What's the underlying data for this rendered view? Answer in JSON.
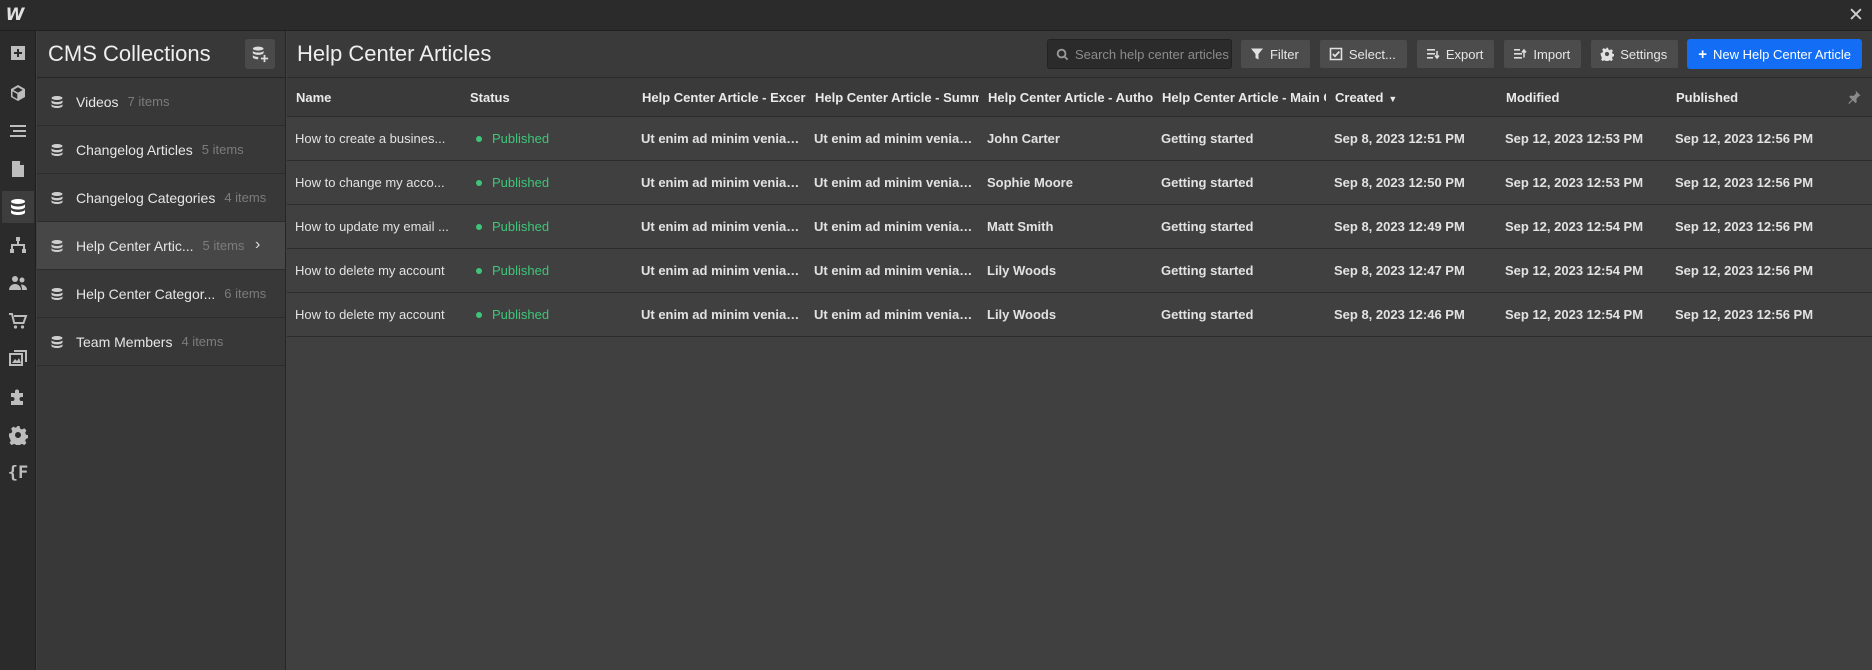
{
  "app": {
    "logo": "W"
  },
  "rail": {
    "icons": [
      "add-icon",
      "cube-icon",
      "navigator-icon",
      "pages-icon",
      "cms-database-icon",
      "logic-icon",
      "users-icon",
      "ecommerce-cart-icon",
      "assets-icon",
      "apps-icon",
      "settings-icon",
      "variables-icon"
    ],
    "variables_label": "{F"
  },
  "collections": {
    "title": "CMS Collections",
    "items": [
      {
        "name": "Videos",
        "count": "7 items"
      },
      {
        "name": "Changelog Articles",
        "count": "5 items"
      },
      {
        "name": "Changelog Categories",
        "count": "4 items"
      },
      {
        "name": "Help Center Artic...",
        "count": "5 items"
      },
      {
        "name": "Help Center Categor...",
        "count": "6 items"
      },
      {
        "name": "Team Members",
        "count": "4 items"
      }
    ]
  },
  "main": {
    "title": "Help Center Articles",
    "search": {
      "placeholder": "Search help center articles..."
    },
    "toolbar": {
      "filter": "Filter",
      "select": "Select...",
      "export": "Export",
      "import": "Import",
      "settings": "Settings",
      "new_item": "New Help Center Article"
    },
    "columns": [
      "Name",
      "Status",
      "Help Center Article - Excerpt",
      "Help Center Article - Summary",
      "Help Center Article - Author",
      "Help Center Article - Main Category",
      "Created",
      "Modified",
      "Published"
    ],
    "sorted_column_indicator": "▼",
    "rows": [
      {
        "name": "How to create a busines...",
        "status": "Published",
        "excerpt": "Ut enim ad minim veniam qu...",
        "summary": "Ut enim ad minim veniam qu...",
        "author": "John Carter",
        "category": "Getting started",
        "created": "Sep 8, 2023 12:51 PM",
        "modified": "Sep 12, 2023 12:53 PM",
        "published": "Sep 12, 2023 12:56 PM"
      },
      {
        "name": "How to change my acco...",
        "status": "Published",
        "excerpt": "Ut enim ad minim veniam qu...",
        "summary": "Ut enim ad minim veniam qu...",
        "author": "Sophie Moore",
        "category": "Getting started",
        "created": "Sep 8, 2023 12:50 PM",
        "modified": "Sep 12, 2023 12:53 PM",
        "published": "Sep 12, 2023 12:56 PM"
      },
      {
        "name": "How to update my email ...",
        "status": "Published",
        "excerpt": "Ut enim ad minim veniam qu...",
        "summary": "Ut enim ad minim veniam qu...",
        "author": "Matt Smith",
        "category": "Getting started",
        "created": "Sep 8, 2023 12:49 PM",
        "modified": "Sep 12, 2023 12:54 PM",
        "published": "Sep 12, 2023 12:56 PM"
      },
      {
        "name": "How to delete my account",
        "status": "Published",
        "excerpt": "Ut enim ad minim veniam qu...",
        "summary": "Ut enim ad minim veniam qu...",
        "author": "Lily Woods",
        "category": "Getting started",
        "created": "Sep 8, 2023 12:47 PM",
        "modified": "Sep 12, 2023 12:54 PM",
        "published": "Sep 12, 2023 12:56 PM"
      },
      {
        "name": "How to delete my account",
        "status": "Published",
        "excerpt": "Ut enim ad minim veniam qu...",
        "summary": "Ut enim ad minim veniam qu...",
        "author": "Lily Woods",
        "category": "Getting started",
        "created": "Sep 8, 2023 12:46 PM",
        "modified": "Sep 12, 2023 12:54 PM",
        "published": "Sep 12, 2023 12:56 PM"
      }
    ]
  },
  "colors": {
    "accent": "#146ef5",
    "published": "#3fc57a",
    "background": "#404040",
    "panel": "#383838"
  }
}
